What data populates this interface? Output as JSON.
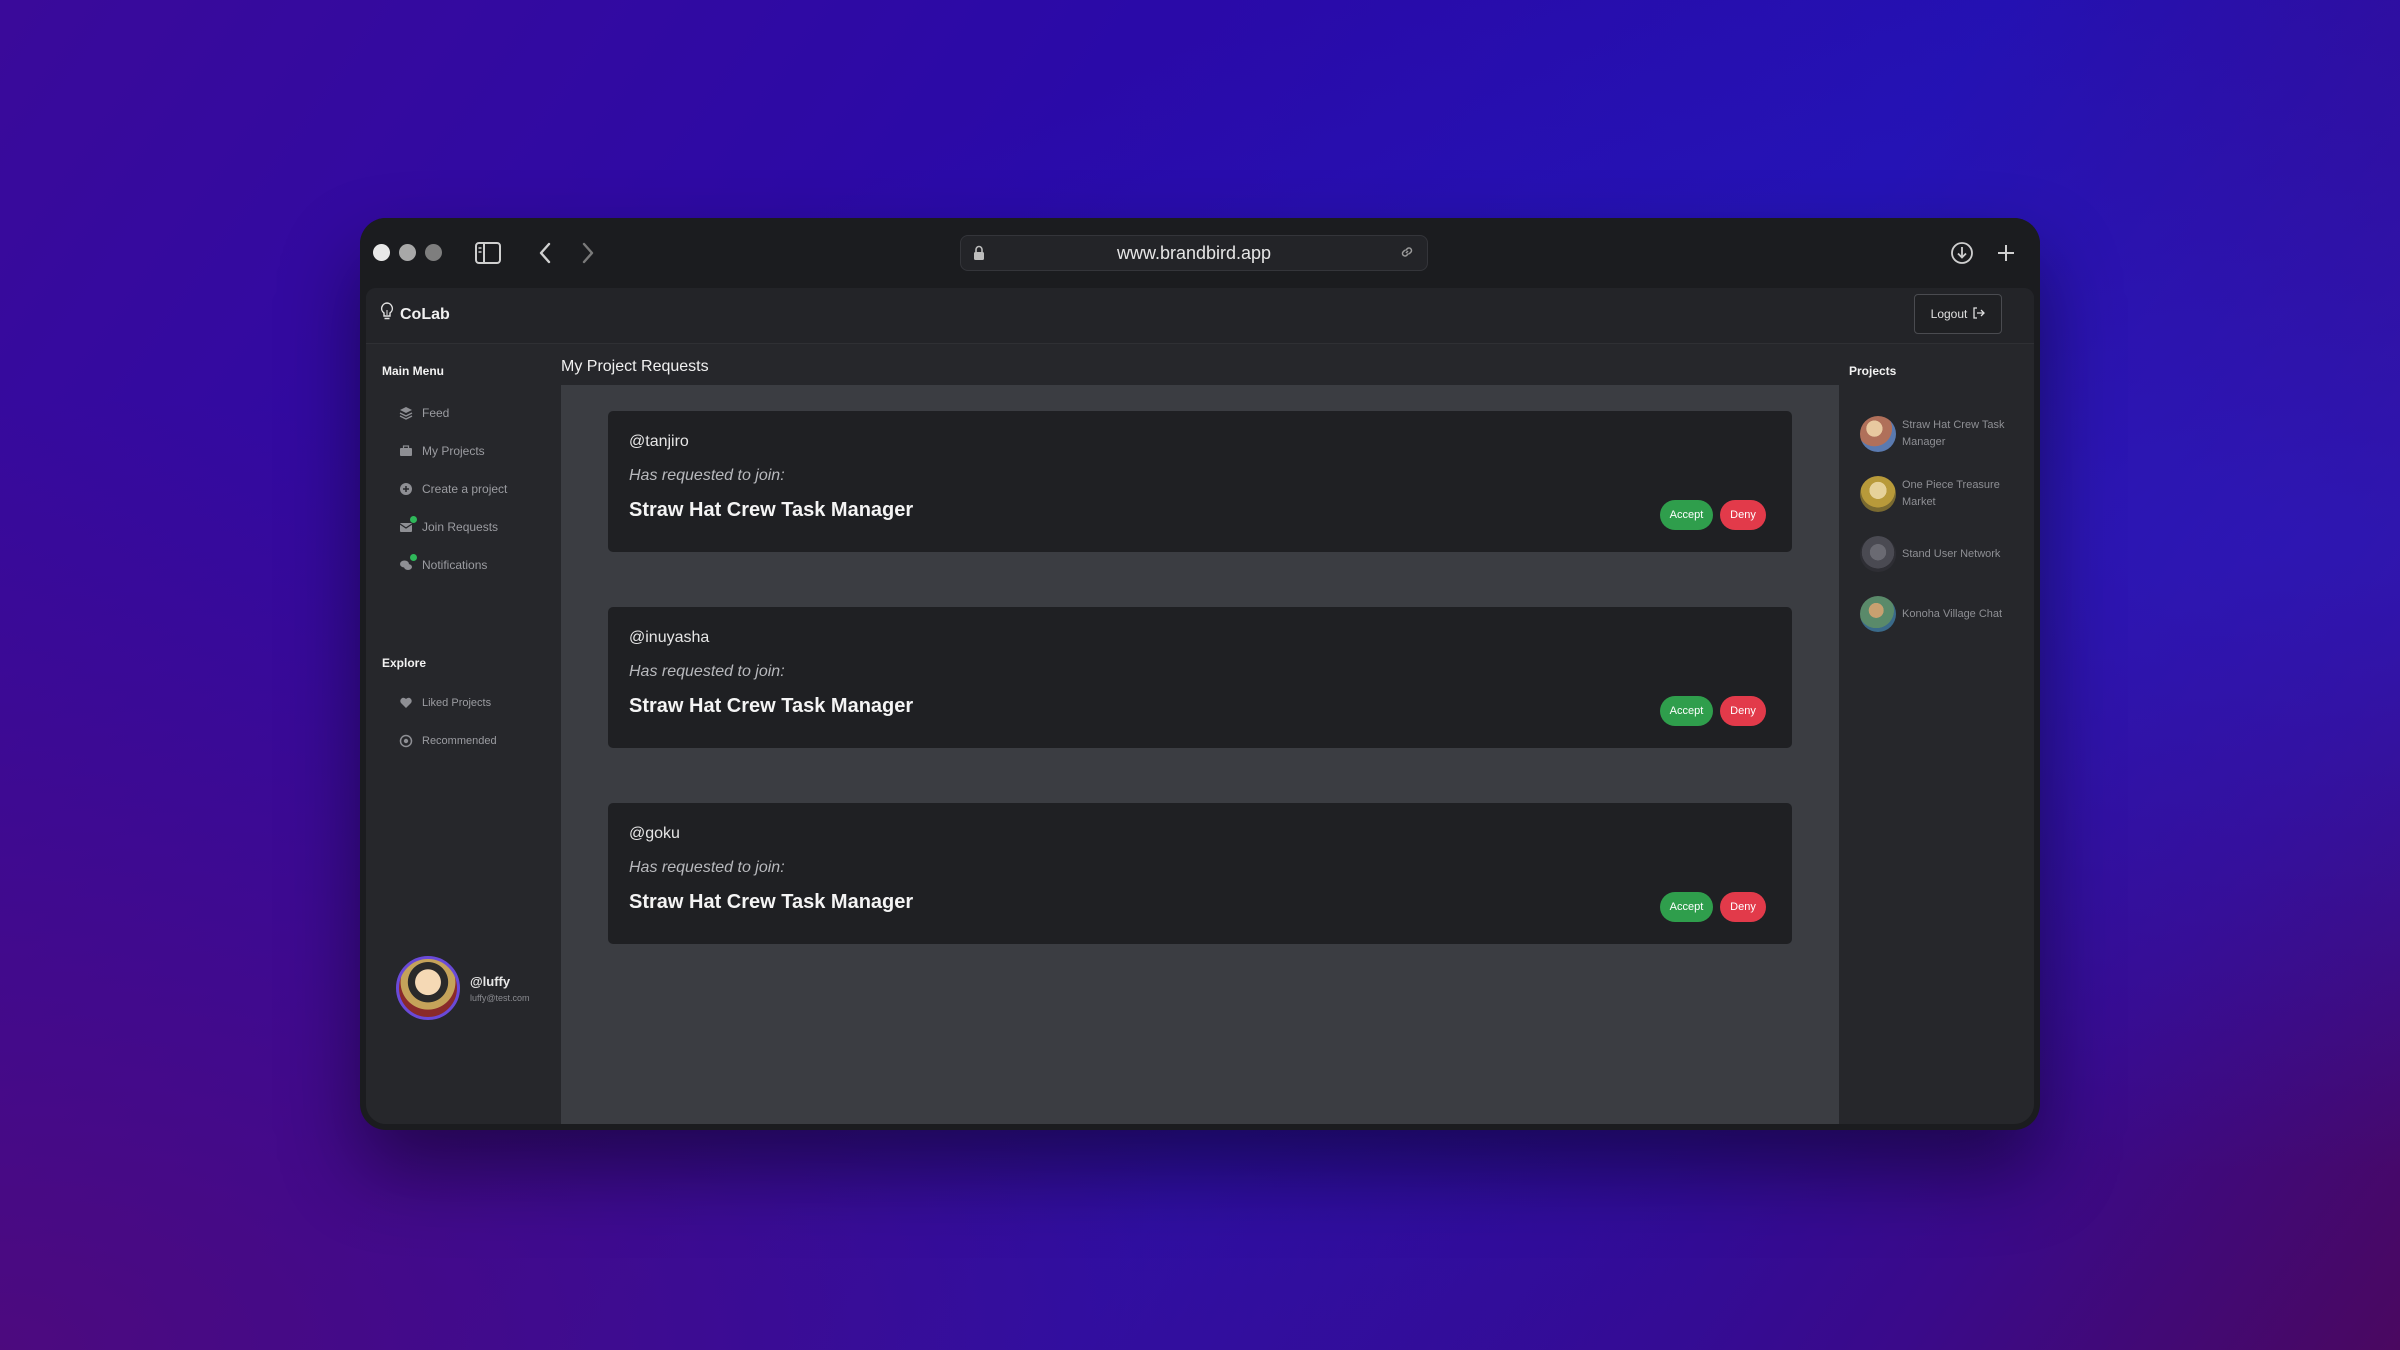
{
  "browser": {
    "url": "www.brandbird.app"
  },
  "app": {
    "brand": "CoLab",
    "logout_label": "Logout"
  },
  "sidebar": {
    "main_menu_heading": "Main Menu",
    "main_items": [
      {
        "label": "Feed",
        "icon": "layers-icon"
      },
      {
        "label": "My Projects",
        "icon": "briefcase-icon"
      },
      {
        "label": "Create a project",
        "icon": "plus-circle-icon"
      },
      {
        "label": "Join Requests",
        "icon": "envelope-icon",
        "badge": true
      },
      {
        "label": "Notifications",
        "icon": "chat-bubbles-icon",
        "badge": true
      }
    ],
    "explore_heading": "Explore",
    "explore_items": [
      {
        "label": "Liked Projects",
        "icon": "heart-icon"
      },
      {
        "label": "Recommended",
        "icon": "target-icon"
      }
    ],
    "user": {
      "handle": "@luffy",
      "email": "luffy@test.com"
    }
  },
  "main": {
    "title": "My Project Requests",
    "requests": [
      {
        "user": "@tanjiro",
        "subtitle": "Has requested to join:",
        "project": "Straw Hat Crew Task Manager",
        "accept": "Accept",
        "deny": "Deny"
      },
      {
        "user": "@inuyasha",
        "subtitle": "Has requested to join:",
        "project": "Straw Hat Crew Task Manager",
        "accept": "Accept",
        "deny": "Deny"
      },
      {
        "user": "@goku",
        "subtitle": "Has requested to join:",
        "project": "Straw Hat Crew Task Manager",
        "accept": "Accept",
        "deny": "Deny"
      }
    ]
  },
  "projects": {
    "heading": "Projects",
    "items": [
      {
        "label": "Straw Hat Crew Task Manager",
        "color": "#b0705a"
      },
      {
        "label": "One Piece Treasure Market",
        "color": "#b89a3a"
      },
      {
        "label": "Stand User Network",
        "color": "#4a4a52"
      },
      {
        "label": "Konoha Village Chat",
        "color": "#5a8a6a"
      }
    ]
  },
  "colors": {
    "accept": "#2f9e4c",
    "deny": "#e23a4a",
    "badge": "#2fb85a"
  }
}
